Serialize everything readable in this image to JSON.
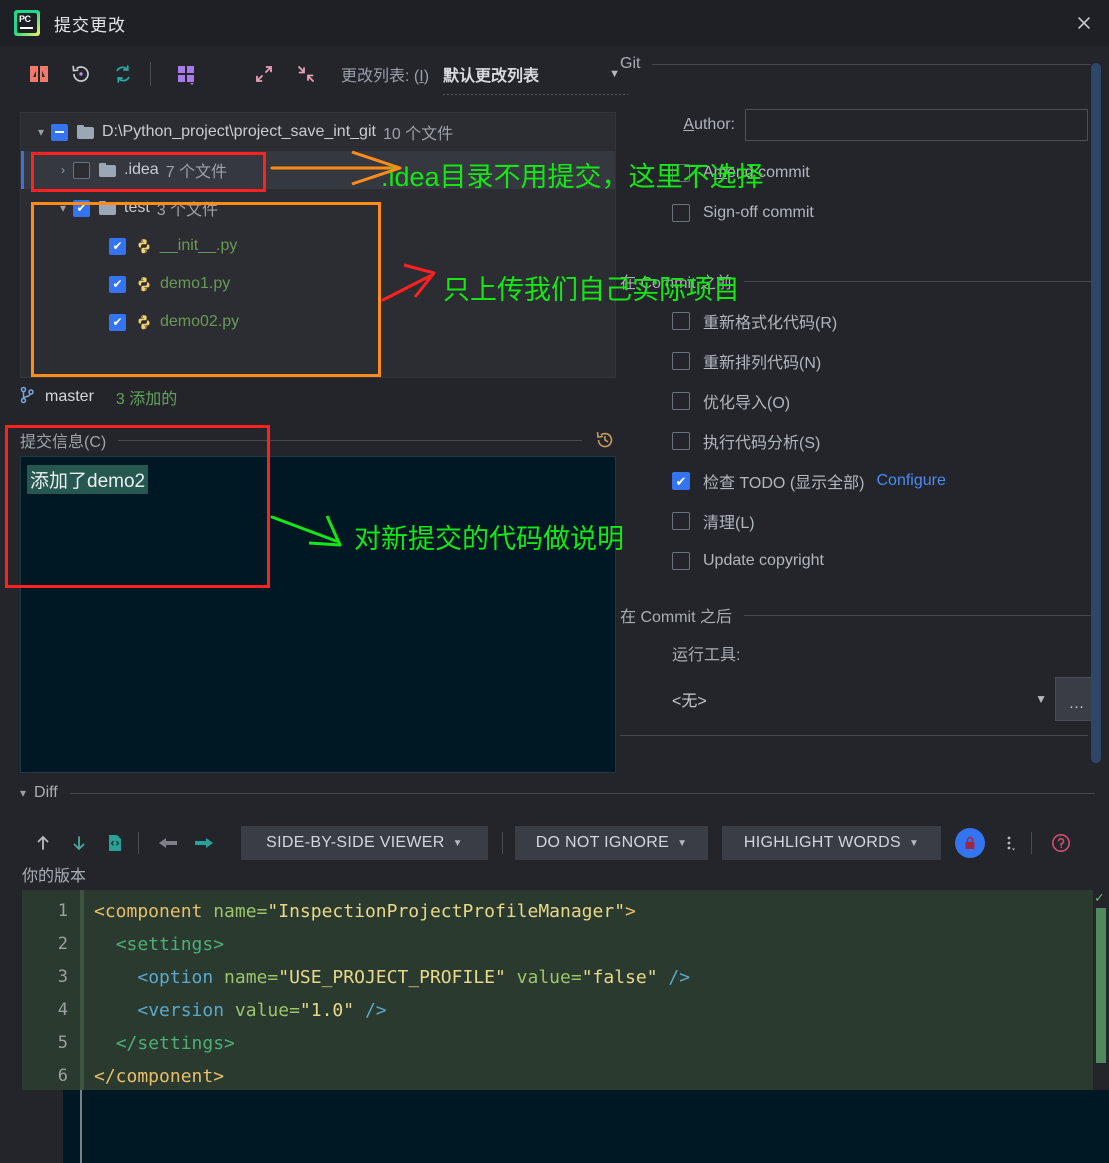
{
  "window": {
    "title": "提交更改",
    "app_icon": "pycharm-logo-icon",
    "close_icon": "close-icon"
  },
  "toolbar": {
    "icons": [
      "diff-icon",
      "revert-icon",
      "refresh-icon",
      "group-by-icon",
      "expand-all-icon",
      "collapse-all-icon"
    ],
    "changelist_label": "更改列表:",
    "changelist_mnemonic": "I",
    "changelist_value": "默认更改列表",
    "dropdown_icon": "chevron-down-icon"
  },
  "tree": {
    "rows": [
      {
        "indent": 0,
        "twisty": "▾",
        "check": "partial",
        "icon": "folder-icon",
        "name": "D:\\Python_project\\project_save_int_git",
        "count": "10 个文件",
        "selected": false
      },
      {
        "indent": 1,
        "twisty": "›",
        "check": "off",
        "icon": "folder-icon",
        "name": ".idea",
        "count": "7 个文件",
        "selected": true
      },
      {
        "indent": 1,
        "twisty": "▾",
        "check": "on",
        "icon": "folder-icon",
        "name": "test",
        "count": "3 个文件",
        "selected": false
      },
      {
        "indent": 2,
        "twisty": "",
        "check": "on",
        "icon": "python-file-icon",
        "name": "__init__.py",
        "count": "",
        "selected": false
      },
      {
        "indent": 2,
        "twisty": "",
        "check": "on",
        "icon": "python-file-icon",
        "name": "demo1.py",
        "count": "",
        "selected": false
      },
      {
        "indent": 2,
        "twisty": "",
        "check": "on",
        "icon": "python-file-icon",
        "name": "demo02.py",
        "count": "",
        "selected": false
      }
    ]
  },
  "branch": {
    "icon": "git-branch-icon",
    "name": "master",
    "status": "3 添加的"
  },
  "commit_message": {
    "label": "提交信息(C)",
    "mnemonic": "C",
    "history_icon": "history-icon",
    "value": "添加了demo2"
  },
  "git_panel": {
    "section_git": "Git",
    "author_label": "Author:",
    "author_mnemonic": "A",
    "author_value": "",
    "checkboxes_git": [
      {
        "label": "Amend commit",
        "checked": false,
        "mnemonic": "A"
      },
      {
        "label": "Sign-off commit",
        "checked": false,
        "mnemonic": "g"
      }
    ],
    "section_before": "在 Commit 之前",
    "checkboxes_before": [
      {
        "label": "重新格式化代码(R)",
        "checked": false
      },
      {
        "label": "重新排列代码(N)",
        "checked": false
      },
      {
        "label": "优化导入(O)",
        "checked": false
      },
      {
        "label": "执行代码分析(S)",
        "checked": false
      },
      {
        "label": "检查 TODO (显示全部)",
        "checked": true,
        "link": "Configure"
      },
      {
        "label": "清理(L)",
        "checked": false
      },
      {
        "label": "Update copyright",
        "checked": false
      }
    ],
    "section_after": "在 Commit 之后",
    "run_tool_label": "运行工具:",
    "run_tool_value": "<无>",
    "run_tool_dropdown_icon": "chevron-down-icon",
    "browse_button": "…"
  },
  "diff": {
    "section_label": "Diff",
    "collapse_icon": "chevron-down-icon",
    "toolbar_icons": [
      "prev-difference-icon",
      "next-difference-icon",
      "jump-to-source-icon",
      "accept-left-icon",
      "accept-right-icon"
    ],
    "viewer_button": "SIDE-BY-SIDE VIEWER",
    "ignore_button": "DO NOT IGNORE",
    "highlight_button": "HIGHLIGHT WORDS",
    "lock_icon": "lock-icon",
    "more_icon": "more-vertical-icon",
    "help_icon": "help-icon",
    "version_label": "你的版本",
    "line_numbers": [
      "1",
      "2",
      "3",
      "4",
      "5",
      "6"
    ],
    "code_lines": [
      [
        {
          "t": "<component",
          "c": "k-tag"
        },
        {
          "t": " name=",
          "c": "k-attr"
        },
        {
          "t": "\"InspectionProjectProfileManager\"",
          "c": "k-str"
        },
        {
          "t": ">",
          "c": "k-tag"
        }
      ],
      [
        {
          "t": "  ",
          "c": ""
        },
        {
          "t": "<settings",
          "c": "k-green"
        },
        {
          "t": ">",
          "c": "k-green"
        }
      ],
      [
        {
          "t": "    ",
          "c": ""
        },
        {
          "t": "<option",
          "c": "k-tag2"
        },
        {
          "t": " name=",
          "c": "k-attr"
        },
        {
          "t": "\"USE_PROJECT_PROFILE\"",
          "c": "k-str"
        },
        {
          "t": " value=",
          "c": "k-attr"
        },
        {
          "t": "\"false\"",
          "c": "k-str"
        },
        {
          "t": " />",
          "c": "k-op"
        }
      ],
      [
        {
          "t": "    ",
          "c": ""
        },
        {
          "t": "<version",
          "c": "k-tag2"
        },
        {
          "t": " value=",
          "c": "k-attr"
        },
        {
          "t": "\"1.0\"",
          "c": "k-str"
        },
        {
          "t": " />",
          "c": "k-op"
        }
      ],
      [
        {
          "t": "  ",
          "c": ""
        },
        {
          "t": "</settings>",
          "c": "k-green"
        }
      ],
      [
        {
          "t": "</component>",
          "c": "k-tag"
        }
      ]
    ]
  },
  "annotations": {
    "note1": ".idea目录不用提交，这里不选择",
    "note2": "只上传我们自己实际项目",
    "note3": "对新提交的代码做说明",
    "colors": {
      "green": "#15e715",
      "red": "#ff2020",
      "orange": "#ff8c1a"
    }
  }
}
